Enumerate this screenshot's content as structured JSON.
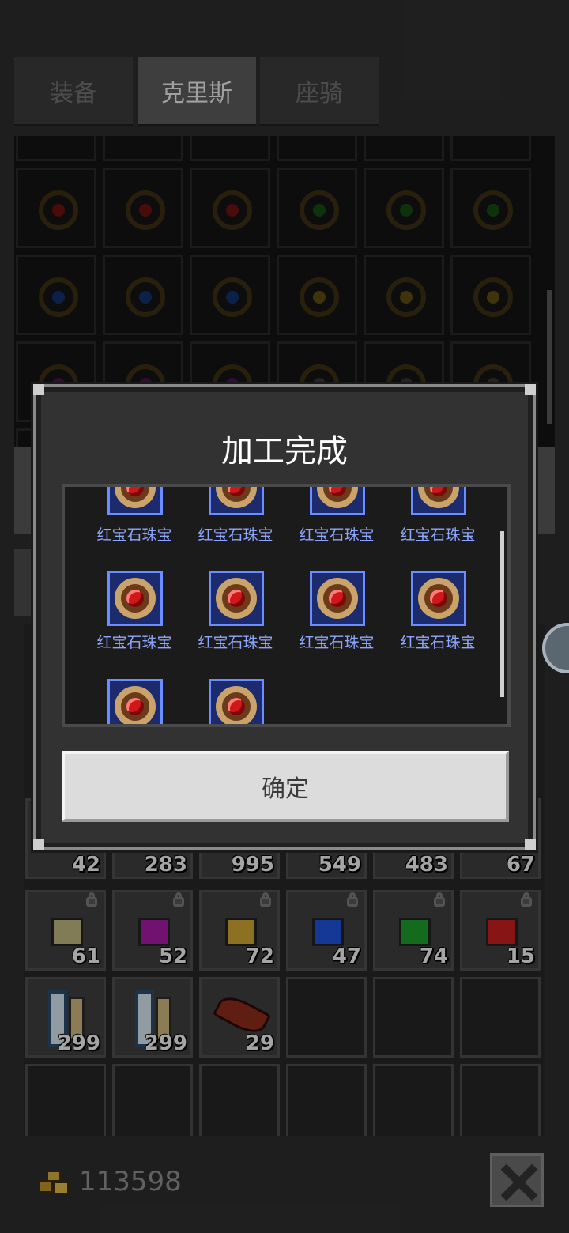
{
  "tabs": [
    {
      "label": "装备",
      "active": false
    },
    {
      "label": "克里斯",
      "active": true
    },
    {
      "label": "座骑",
      "active": false
    }
  ],
  "dialog": {
    "title": "加工完成",
    "items": [
      {
        "name": "红宝石珠宝"
      },
      {
        "name": "红宝石珠宝"
      },
      {
        "name": "红宝石珠宝"
      },
      {
        "name": "红宝石珠宝"
      },
      {
        "name": "红宝石珠宝"
      },
      {
        "name": "红宝石珠宝"
      },
      {
        "name": "红宝石珠宝"
      },
      {
        "name": "红宝石珠宝"
      },
      {
        "name": ""
      },
      {
        "name": ""
      }
    ],
    "confirm_label": "确定"
  },
  "inventory": {
    "row1_counts": [
      "42",
      "283",
      "995",
      "549",
      "483",
      "67"
    ],
    "row2": [
      {
        "count": "61",
        "color": "#b9b27a",
        "locked": true
      },
      {
        "count": "52",
        "color": "#a31aa3",
        "locked": true
      },
      {
        "count": "72",
        "color": "#c9a233",
        "locked": true
      },
      {
        "count": "47",
        "color": "#1f4fd6",
        "locked": true
      },
      {
        "count": "74",
        "color": "#1f9a2a",
        "locked": true
      },
      {
        "count": "15",
        "color": "#c21f1f",
        "locked": true
      }
    ],
    "row3": [
      {
        "count": "299",
        "icon": "scroll-icon"
      },
      {
        "count": "299",
        "icon": "scroll-icon"
      },
      {
        "count": "29",
        "icon": "feather-icon"
      }
    ]
  },
  "gold": {
    "amount": "113598",
    "icon": "gold-coins-icon"
  },
  "close": {
    "icon": "close-icon"
  }
}
